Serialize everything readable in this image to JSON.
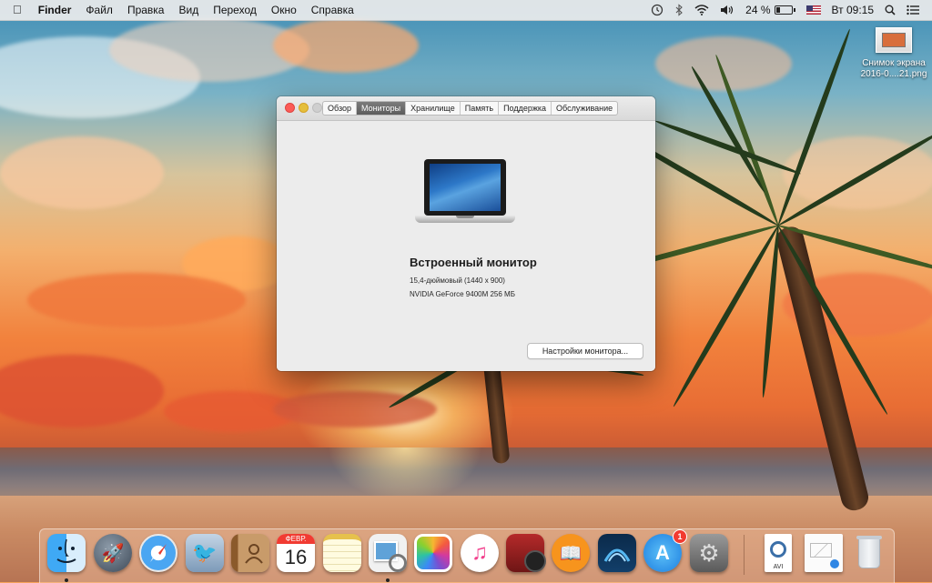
{
  "menubar": {
    "apple_icon": "apple-icon",
    "app_name": "Finder",
    "items": [
      "Файл",
      "Правка",
      "Вид",
      "Переход",
      "Окно",
      "Справка"
    ],
    "status": {
      "battery_percent": "24 %",
      "battery_level": 0.24,
      "clock": "Вт 09:15",
      "icons": [
        "time-machine-icon",
        "bluetooth-icon",
        "wifi-icon",
        "volume-icon",
        "battery-icon",
        "us-flag-icon",
        "spotlight-icon",
        "notification-center-icon"
      ]
    }
  },
  "desktop_file": {
    "line1": "Снимок экрана",
    "line2": "2016-0....21.png"
  },
  "window": {
    "tabs": [
      "Обзор",
      "Мониторы",
      "Хранилище",
      "Память",
      "Поддержка",
      "Обслуживание"
    ],
    "active_tab": "Мониторы",
    "monitor_title": "Встроенный монитор",
    "monitor_size": "15,4-дюймовый (1440 x 900)",
    "monitor_gpu": "NVIDIA GeForce 9400M 256 МБ",
    "settings_button": "Настройки монитора..."
  },
  "dock": {
    "apps": [
      {
        "name": "finder",
        "running": true
      },
      {
        "name": "launchpad",
        "running": false
      },
      {
        "name": "safari",
        "running": false
      },
      {
        "name": "mail",
        "running": false
      },
      {
        "name": "contacts",
        "running": false
      },
      {
        "name": "calendar",
        "running": false,
        "month": "ФЕВР.",
        "day": "16"
      },
      {
        "name": "notes",
        "running": false
      },
      {
        "name": "preview",
        "running": true
      },
      {
        "name": "photos",
        "running": false
      },
      {
        "name": "itunes",
        "running": false
      },
      {
        "name": "photo-booth",
        "running": false
      },
      {
        "name": "ibooks",
        "running": false
      },
      {
        "name": "mac-app",
        "running": false
      },
      {
        "name": "app-store",
        "running": false,
        "badge": "1"
      },
      {
        "name": "system-preferences",
        "running": false
      }
    ],
    "stack": [
      {
        "name": "avi-document",
        "label": "AVI"
      },
      {
        "name": "mail-document"
      },
      {
        "name": "trash"
      }
    ]
  },
  "colors": {
    "menubar_bg": "#ececec",
    "window_bg": "#ececec",
    "active_tab": "#6a6a6a",
    "close": "#fc5b57",
    "minimize": "#e5bf3c",
    "zoom": "#cfcfcf",
    "badge": "#f23b30"
  }
}
